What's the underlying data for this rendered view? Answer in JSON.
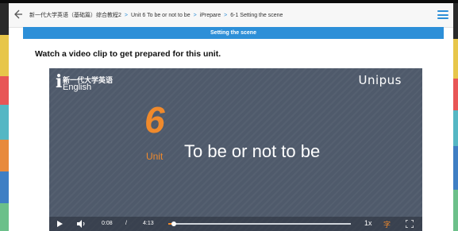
{
  "breadcrumb": {
    "items": [
      "新一代大学英语（基础篇）综合教程2",
      "Unit 6 To be or not to be",
      "iPrepare",
      "6-1 Setting the scene"
    ],
    "separator": ">"
  },
  "title_bar": {
    "label": "Setting the scene"
  },
  "instruction": "Watch a video clip to get prepared for this unit.",
  "video": {
    "brand_cn": "新一代大学英语",
    "brand_en": "English",
    "brand_i": "i",
    "publisher": "Unipus",
    "unit_number": "6",
    "unit_word": "Unit",
    "unit_title": "To be or not to be",
    "current_time": "0:08",
    "time_separator": "/",
    "duration": "4:13",
    "progress_fraction": 0.032,
    "speed_label": "1x",
    "subtitle_button_label": "字"
  },
  "colors": {
    "accent_blue": "#2d8fd8",
    "unit_orange": "#f08a2c",
    "video_bg": "#4f5a6b"
  },
  "icons": {
    "back": "back-arrow-icon",
    "menu": "hamburger-menu-icon",
    "play": "play-icon",
    "volume": "volume-icon",
    "fullscreen": "fullscreen-icon"
  }
}
